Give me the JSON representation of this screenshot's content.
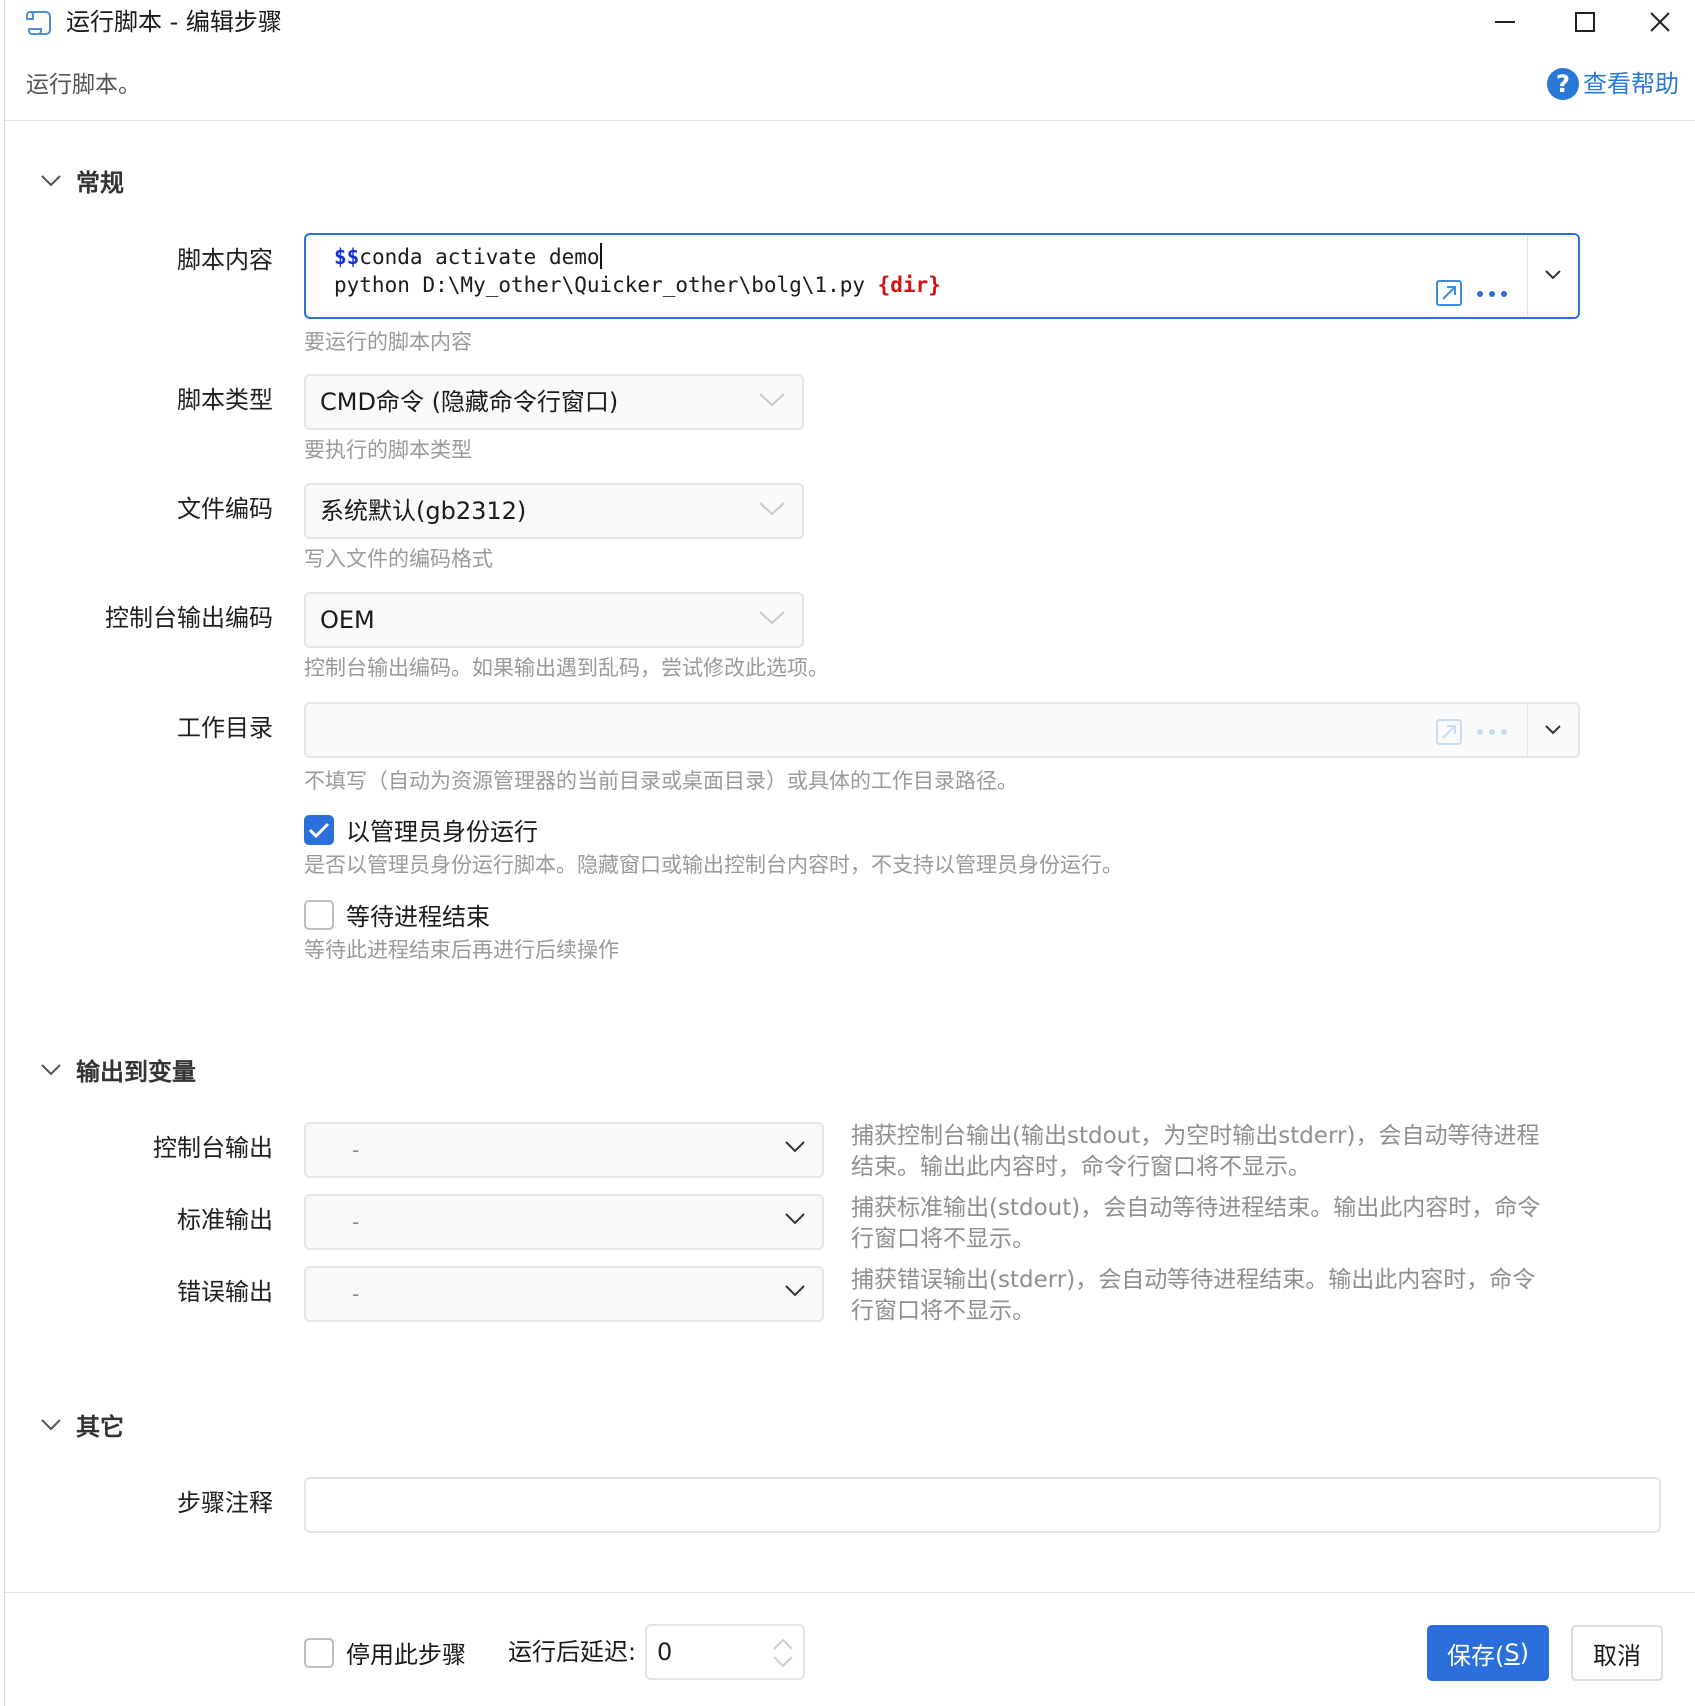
{
  "window": {
    "title": "运行脚本 - 编辑步骤",
    "description": "运行脚本。",
    "help_label": "查看帮助"
  },
  "sections": {
    "general": "常规",
    "output_vars": "输出到变量",
    "other": "其它"
  },
  "script": {
    "label": "脚本内容",
    "line1_prefix": "$$",
    "line1_rest": "conda activate demo",
    "line2_text": "python D:\\My_other\\Quicker_other\\bolg\\1.py ",
    "line2_var": "{dir}",
    "hint": "要运行的脚本内容"
  },
  "script_type": {
    "label": "脚本类型",
    "value": "CMD命令 (隐藏命令行窗口)",
    "hint": "要执行的脚本类型"
  },
  "file_encoding": {
    "label": "文件编码",
    "value": "系统默认(gb2312)",
    "hint": "写入文件的编码格式"
  },
  "console_encoding": {
    "label": "控制台输出编码",
    "value": "OEM",
    "hint": "控制台输出编码。如果输出遇到乱码，尝试修改此选项。"
  },
  "working_dir": {
    "label": "工作目录",
    "value": "",
    "hint": "不填写（自动为资源管理器的当前目录或桌面目录）或具体的工作目录路径。"
  },
  "run_as_admin": {
    "label": "以管理员身份运行",
    "checked": true,
    "hint": "是否以管理员身份运行脚本。隐藏窗口或输出控制台内容时，不支持以管理员身份运行。"
  },
  "wait_exit": {
    "label": "等待进程结束",
    "checked": false,
    "hint": "等待此进程结束后再进行后续操作"
  },
  "outputs": [
    {
      "label": "控制台输出",
      "value": "-",
      "desc": "捕获控制台输出(输出stdout，为空时输出stderr)，会自动等待进程结束。输出此内容时，命令行窗口将不显示。"
    },
    {
      "label": "标准输出",
      "value": "-",
      "desc": "捕获标准输出(stdout)，会自动等待进程结束。输出此内容时，命令行窗口将不显示。"
    },
    {
      "label": "错误输出",
      "value": "-",
      "desc": "捕获错误输出(stderr)，会自动等待进程结束。输出此内容时，命令行窗口将不显示。"
    }
  ],
  "step_note": {
    "label": "步骤注释",
    "value": ""
  },
  "footer": {
    "disable_label": "停用此步骤",
    "disable_checked": false,
    "delay_label": "运行后延迟:",
    "delay_value": "0",
    "save_label": "保存(",
    "save_key": "S",
    "save_suffix": ")",
    "cancel_label": "取消"
  },
  "colors": {
    "accent": "#2a6fdb",
    "link": "#2a78d6",
    "var_prefix": "#1234d6",
    "var_token": "#d31111"
  }
}
